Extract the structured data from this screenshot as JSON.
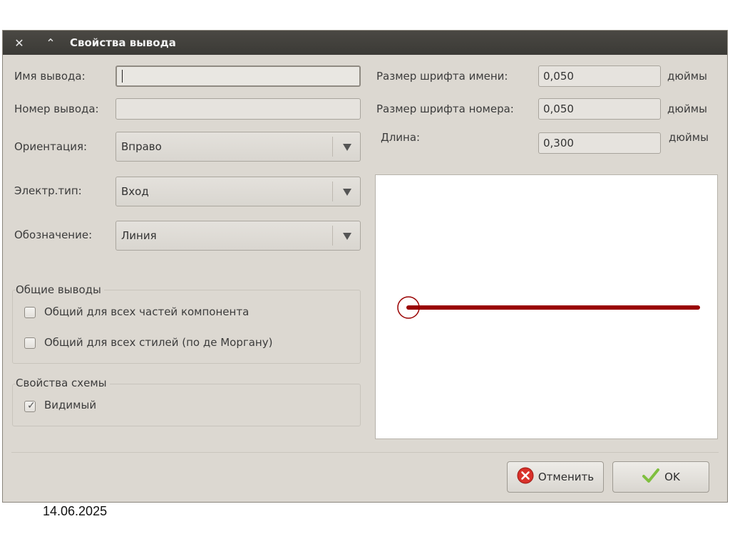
{
  "window": {
    "title": "Свойства вывода",
    "close_symbol": "✕",
    "up_symbol": "⌃"
  },
  "form": {
    "pin_name_label": "Имя вывода:",
    "pin_name_value": "",
    "pin_number_label": "Номер вывода:",
    "pin_number_value": "",
    "orientation_label": "Ориентация:",
    "orientation_value": "Вправо",
    "electrical_type_label": "Электр.тип:",
    "electrical_type_value": "Вход",
    "graphic_style_label": "Обозначение:",
    "graphic_style_value": "Линия"
  },
  "sizes": {
    "name_font_label": "Размер шрифта имени:",
    "name_font_value": "0,050",
    "number_font_label": "Размер шрифта номера:",
    "number_font_value": "0,050",
    "length_label": "Длина:",
    "length_value": "0,300",
    "unit": "дюймы"
  },
  "common_pins": {
    "title": "Общие выводы",
    "all_units_label": "Общий для всех частей компонента",
    "all_units_checked": false,
    "all_styles_label": "Общий для всех стилей (по де Моргану)",
    "all_styles_checked": false
  },
  "schematic": {
    "title": "Свойства схемы",
    "visible_label": "Видимый",
    "visible_checked": true
  },
  "preview": {
    "pin_color": "#990000"
  },
  "buttons": {
    "cancel_label": "Отменить",
    "ok_label": "OK"
  },
  "footer": {
    "date": "14.06.2025"
  }
}
